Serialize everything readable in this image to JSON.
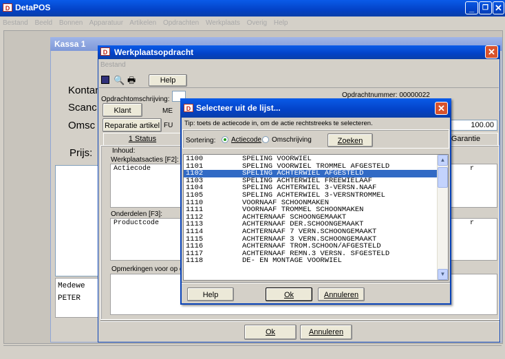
{
  "app": {
    "title": "DetaPOS",
    "menu": [
      "Bestand",
      "Beeld",
      "Bonnen",
      "Apparatuur",
      "Artikelen",
      "Opdrachten",
      "Werkplaats",
      "Overig",
      "Help"
    ]
  },
  "kassa": {
    "title": "Kassa 1",
    "labels": [
      "Kontan",
      "Scanc",
      "Omsc",
      "Prijs:"
    ],
    "medewerker_label": "Medewe",
    "medewerker_value": "PETER"
  },
  "werkplaats": {
    "title": "Werkplaatsopdracht",
    "menu": "Bestand",
    "help_label": "Help",
    "omschrijving_label": "Opdrachtomschrijving:",
    "opdrachtnummer": "Opdrachtnummer: 00000022",
    "klant_label": "Klant",
    "me_label": "ME",
    "reparatie_label": "Reparatie artikel",
    "fu_label": "FU",
    "amount": "100.00",
    "tab_status": "1 Status",
    "tab_garantie": "Garantie",
    "inhoud_label": "Inhoud:",
    "werkplaatsacties_label": "Werkplaatsacties [F2]:",
    "actiecode_header": "Actiecode",
    "onderdelen_label": "Onderdelen [F3]:",
    "productcode_header": "Productcode",
    "opmerkingen_label": "Opmerkingen voor op d",
    "r1": "r",
    "r2": "r",
    "ok_label": "Ok",
    "annuleren_label": "Annuleren"
  },
  "dialog": {
    "title": "Selecteer uit de lijst...",
    "tip": "Tip: toets de actiecode in, om de actie rechtstreeks te selecteren.",
    "sortering_label": "Sortering:",
    "option_actiecode": "Actiecode",
    "option_omschrijving": "Omschrijving",
    "zoeken_label": "Zoeken",
    "help_label": "Help",
    "ok_label": "Ok",
    "annuleren_label": "Annuleren",
    "selected_index": 2,
    "items": [
      {
        "code": "1100",
        "desc": "SPELING VOORWIEL"
      },
      {
        "code": "1101",
        "desc": "SPELING VOORWIEL TROMMEL AFGESTELD"
      },
      {
        "code": "1102",
        "desc": "SPELING ACHTERWIEL AFGESTELD"
      },
      {
        "code": "1103",
        "desc": "SPELING ACHTERWIEL FREEWIELAAF"
      },
      {
        "code": "1104",
        "desc": "SPELING ACHTERWIEL 3-VERSN.NAAF"
      },
      {
        "code": "1105",
        "desc": "SPELING ACHTERWIEL 3-VERSNTROMMEL"
      },
      {
        "code": "1110",
        "desc": "VOORNAAF SCHOONMAKEN"
      },
      {
        "code": "1111",
        "desc": "VOORNAAF TROMMEL SCHOONMAKEN"
      },
      {
        "code": "1112",
        "desc": "ACHTERNAAF SCHOONGEMAAKT"
      },
      {
        "code": "1113",
        "desc": "ACHTERNAAF DER.SCHOONGEMAAKT"
      },
      {
        "code": "1114",
        "desc": "ACHTERNAAF 7 VERN.SCHOONGEMAAKT"
      },
      {
        "code": "1115",
        "desc": "ACHTERNAAF 3 VERN.SCHOONGEMAAKT"
      },
      {
        "code": "1116",
        "desc": "ACHTERNAAF TROM.SCHOON/AFGESTELD"
      },
      {
        "code": "1117",
        "desc": "ACHTERNAAF REMN.3 VERSN. SFGESTELD"
      },
      {
        "code": "1118",
        "desc": "DE- EN MONTAGE VOORWIEL"
      }
    ]
  }
}
